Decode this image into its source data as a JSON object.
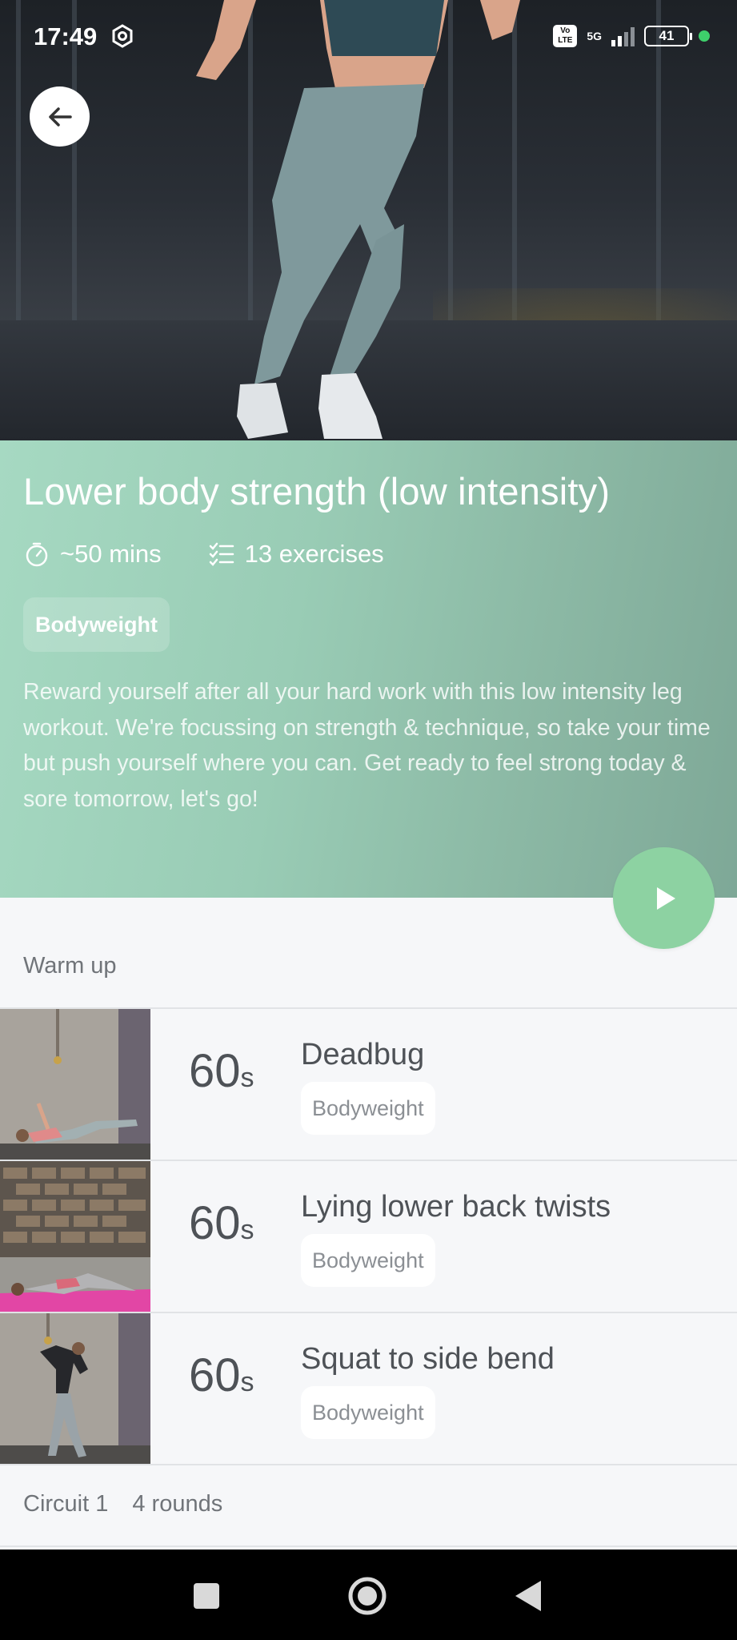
{
  "status_bar": {
    "time": "17:49",
    "network": "5G",
    "volte": "Vo LTE",
    "battery": "41"
  },
  "workout": {
    "title": "Lower body strength (low intensity)",
    "duration": "~50 mins",
    "exercise_count": "13 exercises",
    "equipment_tag": "Bodyweight",
    "description": "Reward yourself after all your hard work with this low intensity leg workout. We're focussing on strength & technique, so take your time but push yourself where you can. Get ready to feel strong today & sore tomorrow, let's go!"
  },
  "sections": {
    "warm_up": "Warm up",
    "circuit_name": "Circuit 1",
    "circuit_rounds": "4 rounds"
  },
  "exercises": [
    {
      "duration": "60",
      "unit": "s",
      "name": "Deadbug",
      "tag": "Bodyweight"
    },
    {
      "duration": "60",
      "unit": "s",
      "name": "Lying lower back twists",
      "tag": "Bodyweight"
    },
    {
      "duration": "60",
      "unit": "s",
      "name": "Squat to side bend",
      "tag": "Bodyweight"
    }
  ],
  "colors": {
    "info_panel": "#99ccb5",
    "play_button": "#8dd2a2",
    "status_dot": "#3ecf6b"
  },
  "icons": {
    "back": "arrow-left-icon",
    "timer": "stopwatch-icon",
    "list": "checklist-icon",
    "play": "play-icon"
  }
}
